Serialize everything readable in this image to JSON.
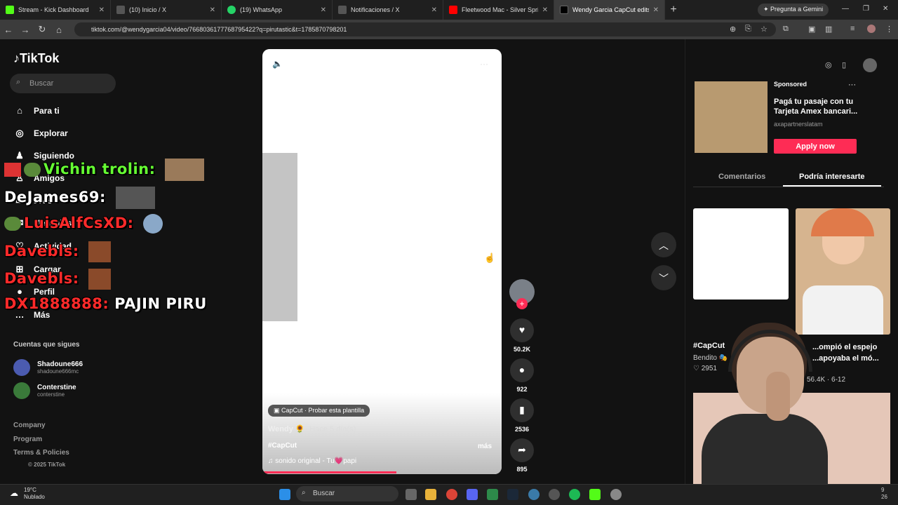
{
  "browser": {
    "tabs": [
      {
        "label": "Stream - Kick Dashboard",
        "color": "#53fc18",
        "icon": "kick-icon"
      },
      {
        "label": "(10) Inicio / X",
        "color": "#111111",
        "icon": "x-icon"
      },
      {
        "label": "(19) WhatsApp",
        "color": "#25d366",
        "icon": "whatsapp-icon"
      },
      {
        "label": "Notificaciones / X",
        "color": "#111111",
        "icon": "x-icon"
      },
      {
        "label": "Fleetwood Mac - Silver Springs",
        "color": "#ff0000",
        "icon": "youtube-icon"
      },
      {
        "label": "Wendy Garcia CapCut edits",
        "color": "#000000",
        "icon": "tiktok-icon"
      }
    ],
    "new_tab": "+",
    "gemini_label": "Pregunta a Gemini",
    "url": "tiktok.com/@wendygarcia04/video/7668036177768795422?q=pirutastic&t=1785870798201"
  },
  "sidebar": {
    "logo": "TikTok",
    "search_placeholder": "Buscar",
    "nav": [
      {
        "label": "Para ti",
        "icon": "home-icon"
      },
      {
        "label": "Explorar",
        "icon": "compass-icon"
      },
      {
        "label": "Siguiendo",
        "icon": "following-icon"
      },
      {
        "label": "Amigos",
        "icon": "friends-icon"
      },
      {
        "label": "LIVE",
        "icon": "live-icon"
      },
      {
        "label": "Mensajes",
        "icon": "messages-icon"
      },
      {
        "label": "Actividad",
        "icon": "activity-icon"
      },
      {
        "label": "Cargar",
        "icon": "upload-icon"
      },
      {
        "label": "Perfil",
        "icon": "profile-icon"
      },
      {
        "label": "Más",
        "icon": "more-icon"
      }
    ],
    "following_title": "Cuentas que sigues",
    "accounts": [
      {
        "name": "Shadoune666",
        "handle": "shadoune666mc"
      },
      {
        "name": "Conterstine",
        "handle": "conterstine"
      }
    ],
    "footer": [
      "Company",
      "Program",
      "Terms & Policies",
      "© 2025 TikTok"
    ]
  },
  "video": {
    "capcut_label": "CapCut · Probar esta plantilla",
    "author": "Wendy 🌻",
    "time_ago": "· Hace 5 día(s)",
    "hashtag": "#CapCut",
    "more": "más",
    "sound": "♫ sonido original - Tu💗papi",
    "progress": 0.56
  },
  "actions": {
    "likes": "50.2K",
    "comments": "922",
    "saves": "2536",
    "shares": "895"
  },
  "ad": {
    "sponsored": "Sponsored",
    "text": "Pagá tu pasaje con tu Tarjeta Amex bancari...",
    "source": "axapartnerslatam",
    "button": "Apply now"
  },
  "right_tabs": {
    "comments": "Comentarios",
    "related": "Podría interesarte"
  },
  "related": [
    {
      "title": "#CapCut",
      "user": "Bendito 🎭",
      "likes": "♡ 2951"
    },
    {
      "title": "...ompió el espejo ...apoyaba el mó...",
      "meta": "56.4K · 6-12"
    }
  ],
  "chat": [
    {
      "user": "Vichin trolin:",
      "text": "",
      "color": "#66ff33"
    },
    {
      "user": "DeJames69:",
      "text": "",
      "color": "#ffffff"
    },
    {
      "user": "LuisAlfCsXD:",
      "text": "",
      "color": "#ff2a2a"
    },
    {
      "user": "Davebls:",
      "text": "",
      "color": "#ff2a2a"
    },
    {
      "user": "Davebls:",
      "text": "",
      "color": "#ff2a2a"
    },
    {
      "user": "DX1888888:",
      "text": "PAJIN PIRU",
      "color": "#ff2a2a"
    }
  ],
  "taskbar": {
    "temp": "19°C",
    "weather": "Nublado",
    "search": "Buscar",
    "time": "9",
    "date": "26"
  }
}
